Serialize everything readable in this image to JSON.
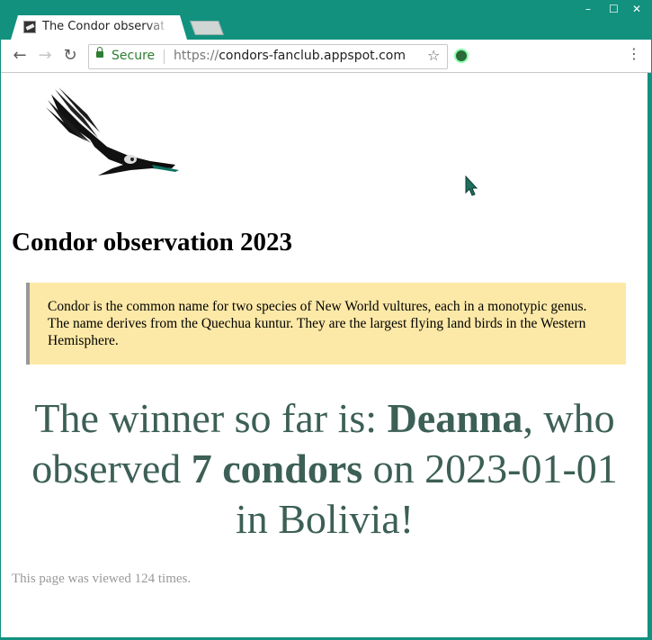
{
  "browser": {
    "tab_title": "The Condor observat",
    "tab_close": "×",
    "window_controls": [
      "–",
      "☐",
      "✕"
    ],
    "secure_label": "Secure",
    "url_prefix": "https://",
    "url_host": "condors-fanclub.appspot.com",
    "icons": {
      "back": "back-arrow-icon",
      "forward": "forward-arrow-icon",
      "reload": "reload-icon",
      "lock": "lock-icon",
      "star": "star-icon",
      "extension": "extension-icon",
      "menu": "kebab-menu-icon"
    },
    "accent_color": "#12917f"
  },
  "page": {
    "heading": "Condor observation 2023",
    "info_text": "Condor is the common name for two species of New World vultures, each in a monotypic genus. The name derives from the Quechua kuntur. They are the largest flying land birds in the Western Hemisphere.",
    "winner": {
      "prefix": "The winner so far is: ",
      "name": "Deanna",
      "mid1": ", who observed ",
      "count_text": "7 condors",
      "mid2": " on 2023-01-01 in Bolivia!"
    },
    "footer": "This page was viewed 124 times.",
    "colors": {
      "info_background": "#fde9a7",
      "winner_text": "#3c5f56",
      "footer_text": "#999999"
    }
  }
}
